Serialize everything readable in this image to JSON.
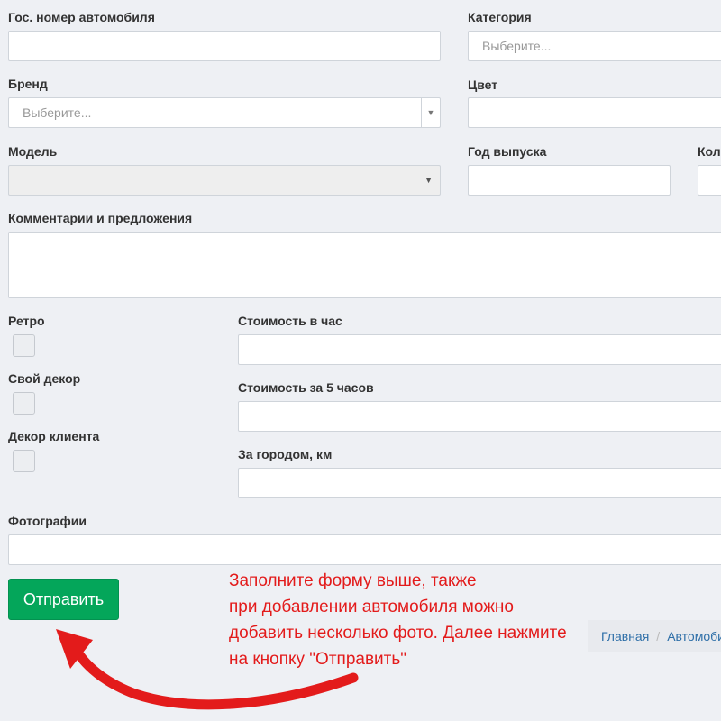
{
  "form": {
    "plate_label": "Гос. номер автомобиля",
    "category_label": "Категория",
    "category_placeholder": "Выберите...",
    "brand_label": "Бренд",
    "brand_placeholder": "Выберите...",
    "color_label": "Цвет",
    "model_label": "Модель",
    "year_label": "Год выпуска",
    "count_label": "Кол",
    "comments_label": "Комментарии и предложения",
    "retro_label": "Ретро",
    "own_decor_label": "Свой декор",
    "client_decor_label": "Декор клиента",
    "price_hour_label": "Стоимость в час",
    "price_5h_label": "Стоимость за 5 часов",
    "outside_city_label": "За городом, км",
    "photos_label": "Фотографии",
    "submit_label": "Отправить"
  },
  "annotation": {
    "lines": [
      "Заполните форму выше, также",
      "при добавлении автомобиля можно",
      "добавить несколько фото. Далее нажмите",
      "на кнопку \"Отправить\""
    ],
    "color": "#e31b1b"
  },
  "breadcrumb": {
    "home": "Главная",
    "separator": "/",
    "current": "Автомоби"
  },
  "colors": {
    "submit_button": "#04a65a",
    "background": "#eef0f4"
  }
}
